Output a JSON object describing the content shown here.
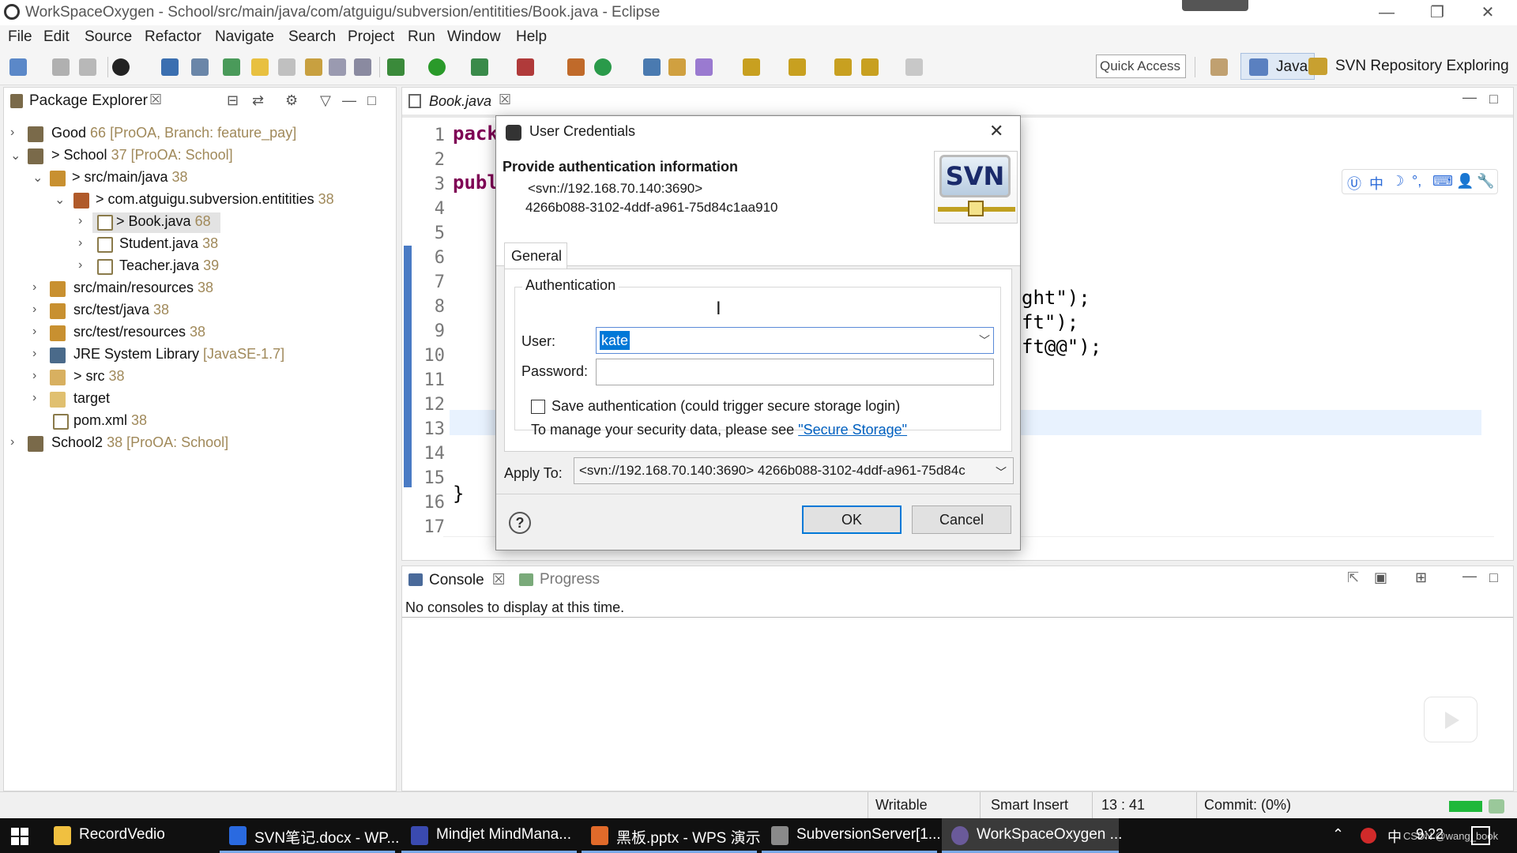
{
  "window": {
    "title": "WorkSpaceOxygen - School/src/main/java/com/atguigu/subversion/entitities/Book.java - Eclipse",
    "min": "—",
    "max": "❐",
    "close": "✕"
  },
  "menu": [
    "File",
    "Edit",
    "Source",
    "Refactor",
    "Navigate",
    "Search",
    "Project",
    "Run",
    "Window",
    "Help"
  ],
  "toolbar": {
    "quick_access": "Quick Access",
    "perspective_java": "Java",
    "perspective_svn": "SVN Repository Exploring"
  },
  "package_explorer": {
    "title": "Package Explorer",
    "close": "☒",
    "rows": [
      {
        "chev": "›",
        "name": "Good",
        "dec": " 66 [ProOA, Branch: feature_pay]"
      },
      {
        "chev": "⌄",
        "name": "> School",
        "dec": " 37 [ProOA: School]"
      },
      {
        "chev": "⌄",
        "name": "> src/main/java",
        "dec": " 38"
      },
      {
        "chev": "⌄",
        "name": "> com.atguigu.subversion.entitities",
        "dec": " 38"
      },
      {
        "chev": "›",
        "name": "> Book.java",
        "dec": " 68"
      },
      {
        "chev": "›",
        "name": "Student.java",
        "dec": " 38"
      },
      {
        "chev": "›",
        "name": "Teacher.java",
        "dec": " 39"
      },
      {
        "chev": "›",
        "name": "src/main/resources",
        "dec": " 38"
      },
      {
        "chev": "›",
        "name": "src/test/java",
        "dec": " 38"
      },
      {
        "chev": "›",
        "name": "src/test/resources",
        "dec": " 38"
      },
      {
        "chev": "›",
        "name": "JRE System Library",
        "dec": " [JavaSE-1.7]"
      },
      {
        "chev": "›",
        "name": "> src",
        "dec": " 38"
      },
      {
        "chev": "›",
        "name": "target",
        "dec": ""
      },
      {
        "chev": "",
        "name": "pom.xml",
        "dec": " 38"
      },
      {
        "chev": "›",
        "name": "School2",
        "dec": " 38 [ProOA: School]"
      }
    ]
  },
  "editor": {
    "tab": "Book.java",
    "close": "☒",
    "line_numbers": [
      "1",
      "2",
      "3",
      "4",
      "5",
      "6",
      "7",
      "8",
      "9",
      "10",
      "11",
      "12",
      "13",
      "14",
      "15",
      "16",
      "17"
    ],
    "code_pack": "pack",
    "code_publ": "publ",
    "code_r8": "ght\");",
    "code_r9": "ft\");",
    "code_r10": "ft@@\");",
    "code_close": "}"
  },
  "console": {
    "tab": "Console",
    "close": "☒",
    "progress_tab": "Progress",
    "message": "No consoles to display at this time."
  },
  "dialog": {
    "title": "User Credentials",
    "close": "✕",
    "heading": "Provide authentication information",
    "url": "<svn://192.168.70.140:3690>",
    "uuid": "4266b088-3102-4ddf-a961-75d84c1aa910",
    "logo_text": "SVN",
    "tab_general": "General",
    "group_auth": "Authentication",
    "user_label": "User:",
    "user_value": "kate",
    "password_label": "Password:",
    "save_auth": "Save authentication (could trigger secure storage login)",
    "manage_text": "To manage your security data, please see ",
    "secure_storage": "\"Secure Storage\"",
    "apply_label": "Apply To:",
    "apply_value": "<svn://192.168.70.140:3690> 4266b088-3102-4ddf-a961-75d84c",
    "help": "?",
    "ok": "OK",
    "cancel": "Cancel"
  },
  "status": {
    "writable": "Writable",
    "insert": "Smart Insert",
    "position": "13 : 41",
    "commit": "Commit: (0%)"
  },
  "taskbar": {
    "items": [
      "RecordVedio",
      "SVN笔记.docx - WP...",
      "Mindjet MindMana...",
      "黑板.pptx - WPS 演示",
      "SubversionServer[1...",
      "WorkSpaceOxygen ..."
    ],
    "ime": "中",
    "clock": "9:22",
    "watermark": "CSDN @wang_book"
  },
  "ime_bar": [
    "Ⓤ",
    "中",
    "☽",
    "°,",
    "⌨",
    "👤",
    "🔧"
  ]
}
